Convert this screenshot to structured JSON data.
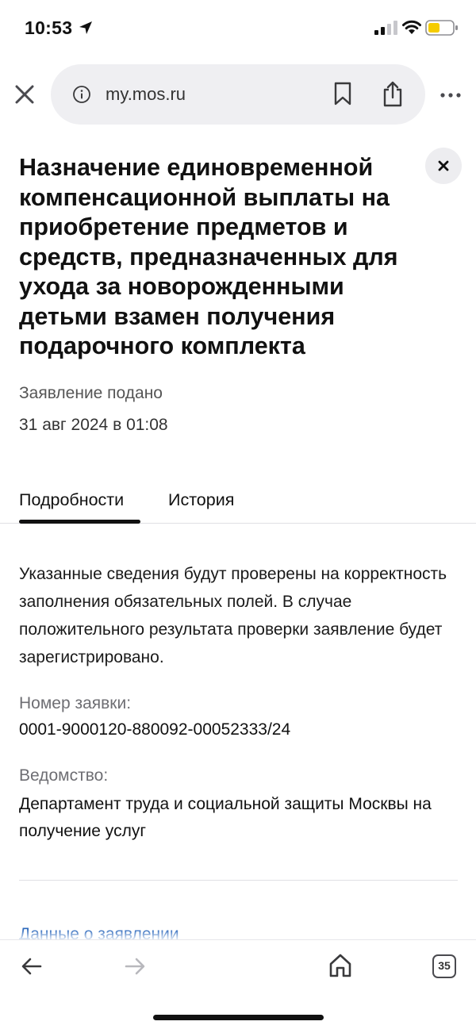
{
  "status_bar": {
    "time": "10:53",
    "battery_color": "#f5cc00"
  },
  "browser": {
    "url": "my.mos.ru"
  },
  "page": {
    "title": "Назначение единовременной компенсационной выплаты на приобретение предметов и средств, предназначенных для ухода за новорожденными детьми взамен получения подарочного комплекта",
    "submitted_label": "Заявление подано",
    "submitted_date": "31 авг 2024 в 01:08",
    "tabs": [
      {
        "label": "Подробности",
        "active": true
      },
      {
        "label": "История",
        "active": false
      }
    ],
    "info_text": "Указанные сведения будут проверены на корректность заполнения обязательных полей. В случае положительного результата проверки заявление будет зарегистрировано.",
    "fields": [
      {
        "label": "Номер заявки:",
        "value": "0001-9000120-880092-00052333/24"
      },
      {
        "label": "Ведомство:",
        "value": "Департамент труда и социальной защиты Москвы на получение услуг"
      }
    ],
    "section_link": "Данные о заявлении",
    "link_color": "#1f5fb8"
  },
  "toolbar": {
    "tab_count": "35"
  }
}
